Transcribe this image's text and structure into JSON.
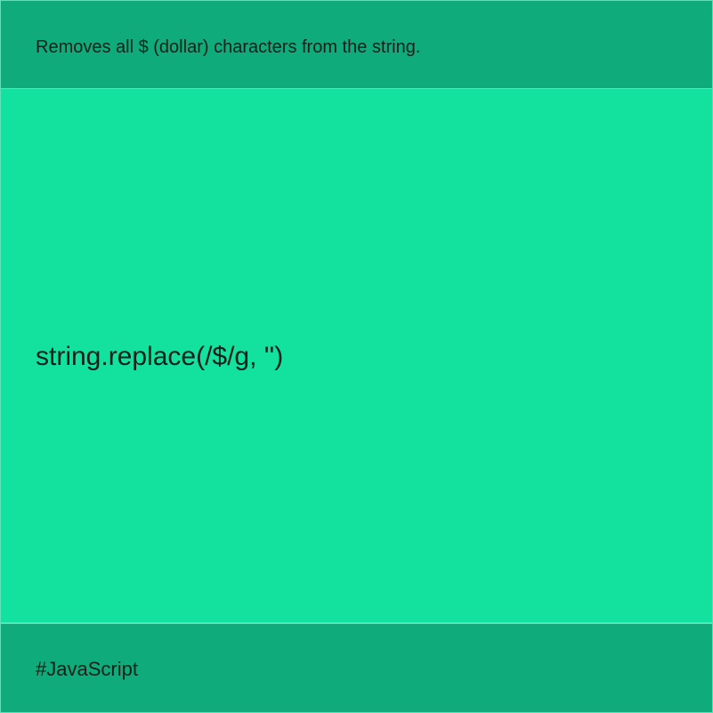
{
  "header": {
    "description": "Removes all $ (dollar) characters from the string."
  },
  "main": {
    "code": "string.replace(/$/g, '')"
  },
  "footer": {
    "tag": "#JavaScript"
  }
}
